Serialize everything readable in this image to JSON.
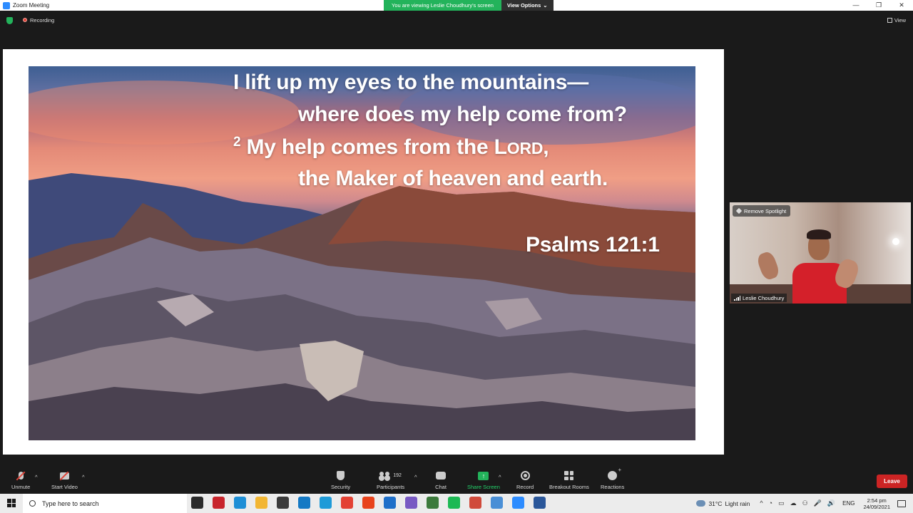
{
  "window": {
    "title": "Zoom Meeting",
    "controls": {
      "minimize": "—",
      "restore": "❐",
      "close": "✕"
    }
  },
  "share_banner": {
    "viewing_text": "You are viewing Leslie Choudhury's screen",
    "view_options_label": "View Options",
    "view_options_caret": "⌄"
  },
  "status": {
    "recording_label": "Recording",
    "view_label": "View"
  },
  "slide": {
    "lines": [
      "I lift up my eyes to the mountains—",
      "where does my help come from?",
      "My help comes from the L",
      "the Maker of heaven and earth."
    ],
    "verse_number": "2",
    "lord_small_caps": "ORD",
    "line3_tail": ",",
    "reference": "Psalms 121:1"
  },
  "video": {
    "spotlight_label": "Remove Spotlight",
    "participant_name": "Leslie Choudhury"
  },
  "toolbar": {
    "unmute": "Unmute",
    "start_video": "Start Video",
    "security": "Security",
    "participants": "Participants",
    "participants_count": "192",
    "chat": "Chat",
    "share_screen": "Share Screen",
    "record": "Record",
    "breakout_rooms": "Breakout Rooms",
    "reactions": "Reactions",
    "leave": "Leave",
    "caret": "^",
    "share_arrow": "↑"
  },
  "taskbar": {
    "search_placeholder": "Type here to search",
    "weather_temp": "31°C",
    "weather_desc": "Light rain",
    "language": "ENG",
    "time": "2:54 pm",
    "date": "24/09/2021",
    "tray_glyphs": [
      "^",
      "◔",
      "▭",
      "☁",
      "⚇",
      "🎤",
      "🔊"
    ],
    "app_icon_colors": [
      "#2b2b2b",
      "#c8252c",
      "#1e8fd6",
      "#f2b632",
      "#3b3b3b",
      "#1479c4",
      "#1f9bd8",
      "#e34234",
      "#e8431c",
      "#1e6fc9",
      "#7859c3",
      "#3c7a3c",
      "#1db954",
      "#d04a3a",
      "#4a8fd6",
      "#2d8cff",
      "#2b579a"
    ],
    "app_icon_names": [
      "task-view-icon",
      "mcafee-icon",
      "edge-icon",
      "file-explorer-icon",
      "store-icon",
      "mail-icon",
      "launcher-icon",
      "chrome-icon",
      "office-icon",
      "skype-icon",
      "viber-icon",
      "calculator-icon",
      "spotify-icon",
      "chrome-profile-icon",
      "chrome-alt-icon",
      "zoom-icon",
      "word-icon"
    ]
  },
  "colors": {
    "share_green": "#23b35b",
    "leave_red": "#cc2424",
    "zoom_blue": "#2d8cff"
  }
}
